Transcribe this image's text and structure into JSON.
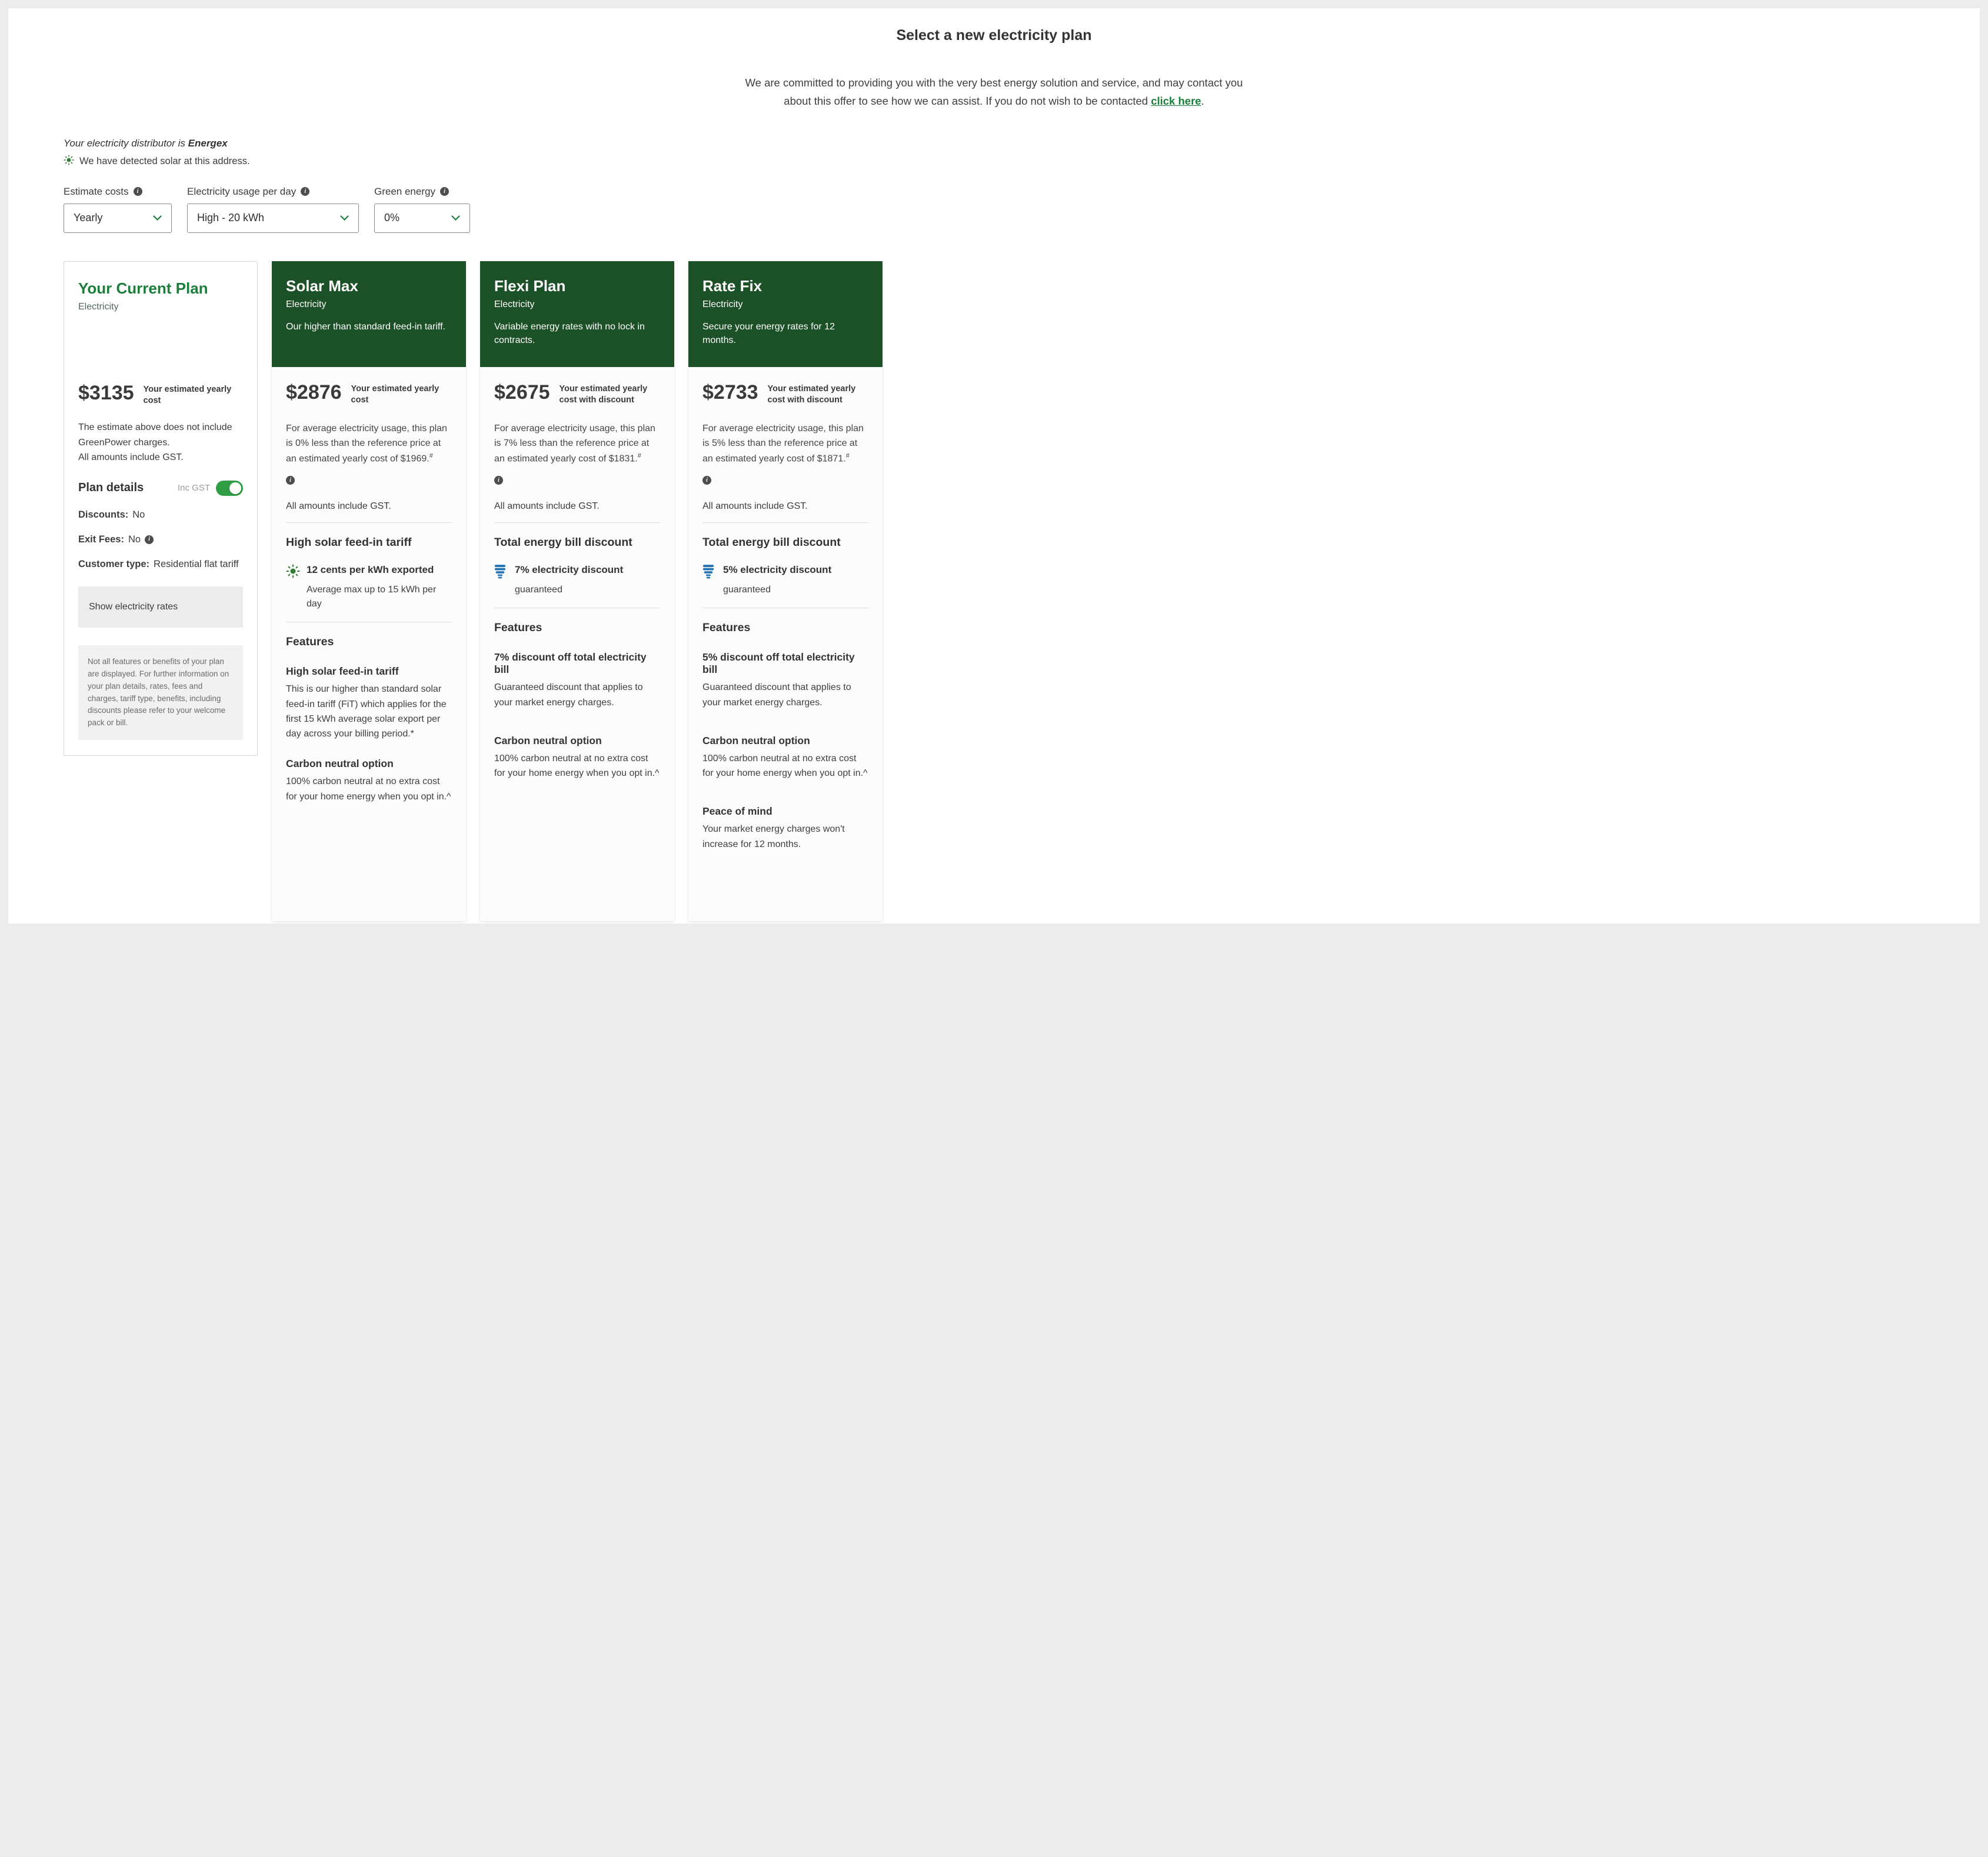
{
  "page": {
    "title": "Select a new electricity plan",
    "intro_line1": "We are committed to providing you with the very best energy solution and service, and may contact you",
    "intro_line2": "about this offer to see how we can assist. If you do not wish to be contacted ",
    "intro_link": "click here",
    "intro_suffix": ".",
    "distributor_prefix": "Your electricity distributor is ",
    "distributor_name": "Energex",
    "solar_notice": "We have detected solar at this address."
  },
  "colors": {
    "header_green": "#1c5127",
    "accent_green": "#1b7e3b",
    "toggle_green": "#2f9e44",
    "bulb_blue": "#2473b5"
  },
  "filters": {
    "estimate": {
      "label": "Estimate costs",
      "value": "Yearly"
    },
    "usage": {
      "label": "Electricity usage per day",
      "value": "High - 20 kWh"
    },
    "green": {
      "label": "Green energy",
      "value": "0%"
    }
  },
  "current_plan": {
    "title": "Your Current Plan",
    "type": "Electricity",
    "price": "$3135",
    "price_caption": "Your estimated yearly cost",
    "note_line1": "The estimate above does not include GreenPower charges.",
    "note_line2": "All amounts include GST.",
    "details_heading": "Plan details",
    "inc_gst_label": "Inc GST",
    "rows": [
      {
        "label": "Discounts:",
        "value": "No"
      },
      {
        "label": "Exit Fees:",
        "value": "No"
      },
      {
        "label": "Customer type:",
        "value": "Residential flat tariff"
      }
    ],
    "show_rates_label": "Show electricity rates",
    "disclaimer": "Not all features or benefits of your plan are displayed. For further information on your plan details, rates, fees and charges, tariff type, benefits, including discounts please refer to your welcome pack or bill."
  },
  "plans": [
    {
      "name": "Solar Max",
      "type": "Electricity",
      "tagline": "Our higher than standard feed-in tariff.",
      "price": "$2876",
      "price_caption": "Your estimated yearly cost",
      "reference_text": "For average electricity usage, this plan is 0% less than the reference price at an estimated yearly cost of $1969.",
      "reference_sup": "#",
      "gst_note": "All amounts include GST.",
      "highlight_heading": "High solar feed-in tariff",
      "highlight_icon": "sun",
      "highlight_title": "12 cents per kWh exported",
      "highlight_sub": "Average max up to 15 kWh per day",
      "features_heading": "Features",
      "features": [
        {
          "title": "High solar feed-in tariff",
          "text": "This is our higher than standard solar feed-in tariff (FiT) which applies for the first 15 kWh average solar export per day across your billing period.*"
        },
        {
          "title": "Carbon neutral option",
          "text": "100% carbon neutral at no extra cost for your home energy when you opt in.^"
        }
      ]
    },
    {
      "name": "Flexi Plan",
      "type": "Electricity",
      "tagline": "Variable energy rates with no lock in contracts.",
      "price": "$2675",
      "price_caption": "Your estimated yearly cost with discount",
      "reference_text": "For average electricity usage, this plan is 7% less than the reference price at an estimated yearly cost of $1831.",
      "reference_sup": "#",
      "gst_note": "All amounts include GST.",
      "highlight_heading": "Total energy bill discount",
      "highlight_icon": "bulb",
      "highlight_title": "7% electricity discount",
      "highlight_sub": "guaranteed",
      "features_heading": "Features",
      "features": [
        {
          "title": "7% discount off total electricity bill",
          "text": "Guaranteed discount that applies to your market energy charges."
        },
        {
          "title": "Carbon neutral option",
          "text": "100% carbon neutral at no extra cost for your home energy when you opt in.^"
        }
      ]
    },
    {
      "name": "Rate Fix",
      "type": "Electricity",
      "tagline": "Secure your energy rates for 12 months.",
      "price": "$2733",
      "price_caption": "Your estimated yearly cost with discount",
      "reference_text": "For average electricity usage, this plan is 5% less than the reference price at an estimated yearly cost of $1871.",
      "reference_sup": "#",
      "gst_note": "All amounts include GST.",
      "highlight_heading": "Total energy bill discount",
      "highlight_icon": "bulb",
      "highlight_title": "5% electricity discount",
      "highlight_sub": "guaranteed",
      "features_heading": "Features",
      "features": [
        {
          "title": "5% discount off total electricity bill",
          "text": "Guaranteed discount that applies to your market energy charges."
        },
        {
          "title": "Carbon neutral option",
          "text": "100% carbon neutral at no extra cost for your home energy when you opt in.^"
        },
        {
          "title": "Peace of mind",
          "text": "Your market energy charges won't increase for 12 months."
        }
      ]
    }
  ]
}
